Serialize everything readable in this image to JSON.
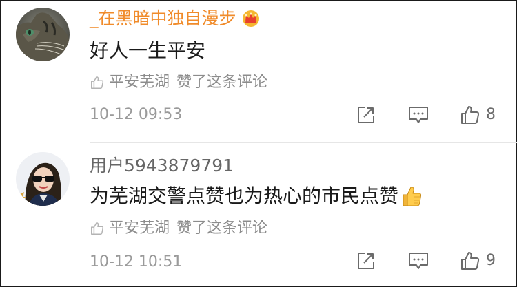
{
  "comments": [
    {
      "username": "_在黑暗中独自漫步",
      "badge_icon": "crown-icon",
      "content": "好人一生平安",
      "liked_by": "平安芜湖",
      "liked_text": "赞了这条评论",
      "timestamp": "10-12 09:53",
      "like_count": "8"
    },
    {
      "username": "用户5943879791",
      "content": "为芜湖交警点赞也为热心的市民点赞",
      "content_emoji": "thumbs-up-emoji",
      "liked_by": "平安芜湖",
      "liked_text": "赞了这条评论",
      "timestamp": "10-12 10:51",
      "like_count": "9"
    }
  ],
  "colors": {
    "username_highlight": "#f08b2a",
    "username_normal": "#666666",
    "content": "#1a1a1a",
    "meta": "#8c8c8c",
    "divider": "#e6e6e6"
  }
}
